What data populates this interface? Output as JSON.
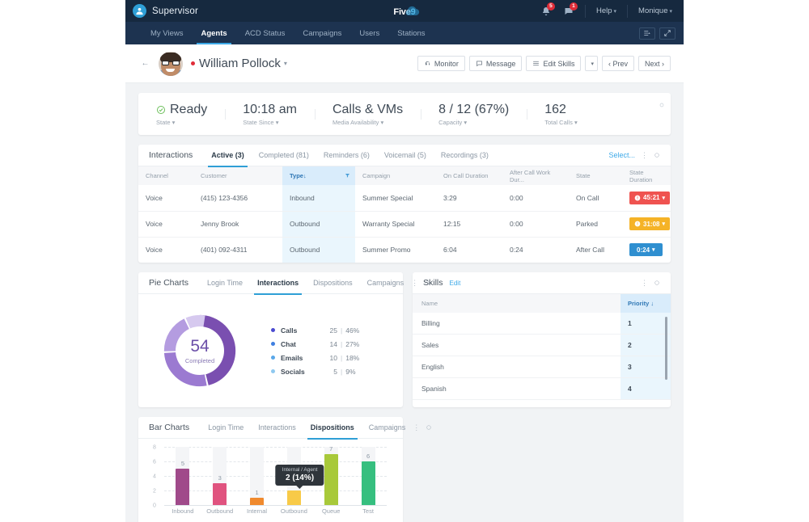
{
  "topbar": {
    "brand": "Supervisor",
    "logo_text": "Five",
    "logo_nine": "9",
    "notifications_badge": "5",
    "messages_badge": "1",
    "help": "Help",
    "user": "Monique"
  },
  "subnav": {
    "items": [
      {
        "label": "My Views"
      },
      {
        "label": "Agents"
      },
      {
        "label": "ACD Status"
      },
      {
        "label": "Campaigns"
      },
      {
        "label": "Users"
      },
      {
        "label": "Stations"
      }
    ],
    "active": "Agents"
  },
  "agent_header": {
    "name": "William Pollock",
    "monitor": "Monitor",
    "message": "Message",
    "edit_skills": "Edit Skills",
    "prev": "‹ Prev",
    "next": "Next ›"
  },
  "stats": [
    {
      "value": "Ready",
      "label": "State"
    },
    {
      "value": "10:18 am",
      "label": "State Since"
    },
    {
      "value": "Calls & VMs",
      "label": "Media Availability"
    },
    {
      "value": "8 / 12 (67%)",
      "label": "Capacity"
    },
    {
      "value": "162",
      "label": "Total Calls"
    }
  ],
  "interactions": {
    "title": "Interactions",
    "tabs": [
      {
        "label": "Active (3)"
      },
      {
        "label": "Completed (81)"
      },
      {
        "label": "Reminders (6)"
      },
      {
        "label": "Voicemail (5)"
      },
      {
        "label": "Recordings (3)"
      }
    ],
    "active_tab": "Active (3)",
    "select_link": "Select...",
    "columns": [
      "Channel",
      "Customer",
      "Type",
      "Campaign",
      "On Call Duration",
      "After Call Work Dur...",
      "State",
      "State Duration"
    ],
    "sorted_column": "Type",
    "rows": [
      {
        "channel": "Voice",
        "customer": "(415) 123-4356",
        "type": "Inbound",
        "campaign": "Summer Special",
        "on_call": "3:29",
        "acw": "0:00",
        "state": "On Call",
        "duration": "45:21",
        "badge_color": "#ef5350",
        "badge_warn": true
      },
      {
        "channel": "Voice",
        "customer": "Jenny Brook",
        "type": "Outbound",
        "campaign": "Warranty Special",
        "on_call": "12:15",
        "acw": "0:00",
        "state": "Parked",
        "duration": "31:08",
        "badge_color": "#f5b327",
        "badge_warn": true
      },
      {
        "channel": "Voice",
        "customer": "(401) 092-4311",
        "type": "Outbound",
        "campaign": "Summer Promo",
        "on_call": "6:04",
        "acw": "0:24",
        "state": "After Call",
        "duration": "0:24",
        "badge_color": "#2f8fd0",
        "badge_warn": false
      }
    ]
  },
  "pie_panel": {
    "title": "Pie Charts",
    "tabs": [
      {
        "label": "Login Time"
      },
      {
        "label": "Interactions"
      },
      {
        "label": "Dispositions"
      },
      {
        "label": "Campaigns"
      }
    ],
    "active_tab": "Interactions"
  },
  "skills": {
    "title": "Skills",
    "edit": "Edit",
    "columns": [
      "Name",
      "Priority"
    ],
    "rows": [
      {
        "name": "Billing",
        "priority": "1"
      },
      {
        "name": "Sales",
        "priority": "2"
      },
      {
        "name": "English",
        "priority": "3"
      },
      {
        "name": "Spanish",
        "priority": "4"
      }
    ]
  },
  "bar_panel": {
    "title": "Bar Charts",
    "tabs": [
      {
        "label": "Login Time"
      },
      {
        "label": "Interactions"
      },
      {
        "label": "Dispositions"
      },
      {
        "label": "Campaigns"
      }
    ],
    "active_tab": "Dispositions"
  },
  "chart_data": [
    {
      "type": "pie",
      "title": "Interactions",
      "center_value": "54",
      "center_label": "Completed",
      "total": 54,
      "legend_position": "right",
      "slices": [
        {
          "name": "Calls",
          "value": 25,
          "percent": "46%",
          "count_label": "25",
          "color": "#7a4fb0"
        },
        {
          "name": "Chat",
          "value": 14,
          "percent": "27%",
          "count_label": "14",
          "color": "#9b7ad1"
        },
        {
          "name": "Emails",
          "value": 10,
          "percent": "18%",
          "count_label": "10",
          "color": "#b49ce0"
        },
        {
          "name": "Socials",
          "value": 5,
          "percent": "9%",
          "count_label": "5",
          "color": "#d6c9ef"
        }
      ],
      "legend_dot_colors": [
        "#4a4ad0",
        "#3f7fe0",
        "#5aa7e8",
        "#8fc9f0"
      ]
    },
    {
      "type": "bar",
      "title": "Dispositions",
      "categories": [
        "Inbound",
        "Outbound",
        "Internal",
        "Outbound",
        "Queue",
        "Test"
      ],
      "values": [
        5,
        3,
        1,
        2,
        7,
        6
      ],
      "colors": [
        "#a04a8a",
        "#e0537f",
        "#f08a2e",
        "#f8ca48",
        "#a8c93a",
        "#36bf7f"
      ],
      "ylim": [
        0,
        8
      ],
      "yticks": [
        "8",
        "6",
        "4",
        "2",
        "0"
      ],
      "grid": true,
      "xlabel": "",
      "ylabel": "",
      "tooltip": {
        "title": "Internal / Agent",
        "value": "2 (14%)",
        "index": 3
      }
    }
  ]
}
